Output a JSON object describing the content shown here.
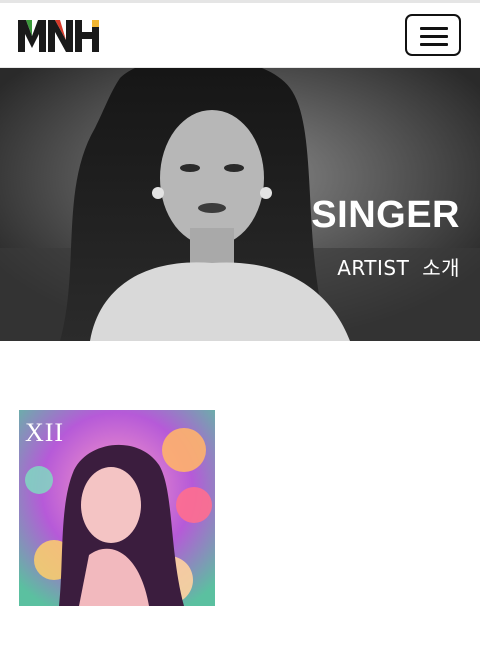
{
  "header": {
    "logo_text": "MNH",
    "menu_icon": "hamburger-icon"
  },
  "hero": {
    "title": "SINGER",
    "subtitle": "ARTIST 소개"
  },
  "albums": [
    {
      "cover_logo": "XII"
    }
  ],
  "colors": {
    "logo_dark": "#1a1a1a",
    "logo_green": "#3b9a3b",
    "logo_red": "#d83a2a",
    "logo_yellow": "#f2b632"
  }
}
